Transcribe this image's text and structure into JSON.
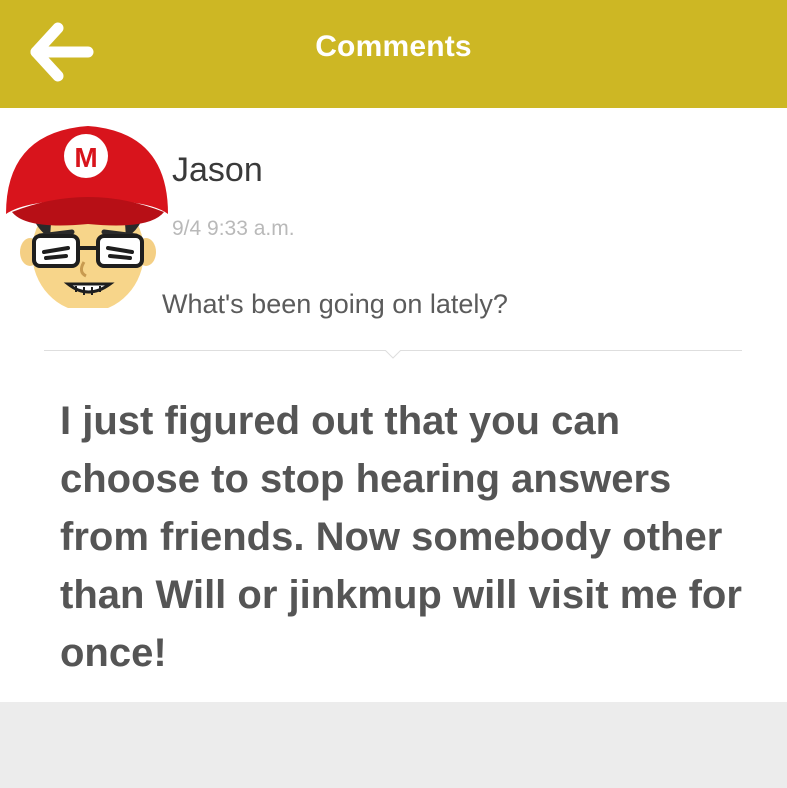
{
  "header": {
    "title": "Comments",
    "back_icon": "arrow-left-icon",
    "color": "#cdb724"
  },
  "post": {
    "author": "Jason",
    "timestamp": "9/4 9:33 a.m.",
    "question": "What's been going on lately?",
    "answer": "I just figured out that you can choose to stop hearing answers from friends. Now somebody other than Will or jinkmup will visit me for once!",
    "avatar": {
      "icon": "mii-avatar-icon",
      "cap_letter": "M",
      "cap_color": "#d8141c"
    }
  }
}
